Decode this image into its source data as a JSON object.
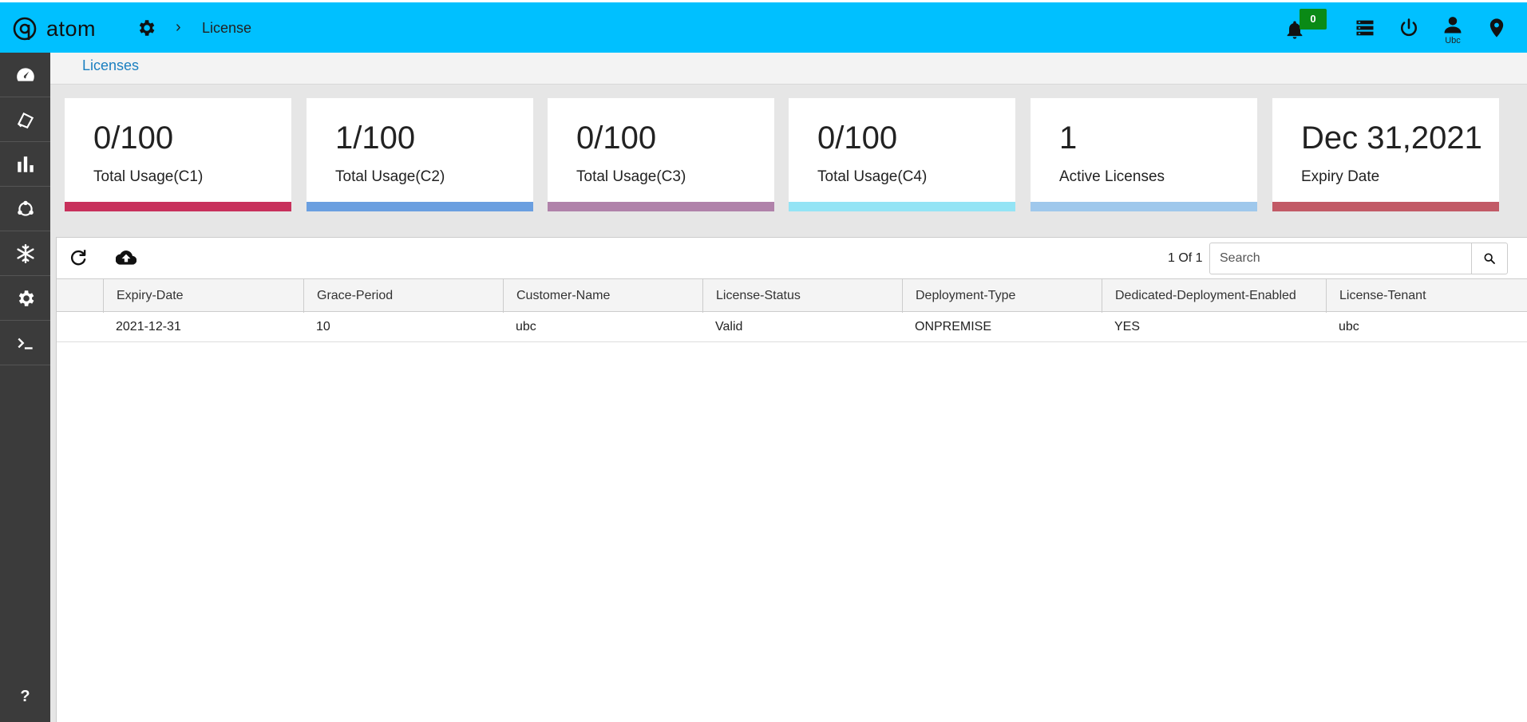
{
  "header": {
    "logo_text": "atom",
    "breadcrumb": "License",
    "notification_count": "0",
    "user_label": "Ubc"
  },
  "subheader": {
    "tab": "Licenses"
  },
  "cards": [
    {
      "value": "0/100",
      "label": "Total Usage(C1)",
      "color": "#c8315c"
    },
    {
      "value": "1/100",
      "label": "Total Usage(C2)",
      "color": "#6a9fe0"
    },
    {
      "value": "0/100",
      "label": "Total Usage(C3)",
      "color": "#b082aa"
    },
    {
      "value": "0/100",
      "label": "Total Usage(C4)",
      "color": "#94e4f5"
    },
    {
      "value": "1",
      "label": "Active Licenses",
      "color": "#9fc8ec"
    },
    {
      "value": "Dec 31,2021",
      "label": "Expiry Date",
      "color": "#c25a66"
    }
  ],
  "table": {
    "page_info": "1 Of 1",
    "search_placeholder": "Search",
    "columns": [
      "Expiry-Date",
      "Grace-Period",
      "Customer-Name",
      "License-Status",
      "Deployment-Type",
      "Dedicated-Deployment-Enabled",
      "License-Tenant"
    ],
    "rows": [
      [
        "2021-12-31",
        "10",
        "ubc",
        "Valid",
        "ONPREMISE",
        "YES",
        "ubc"
      ]
    ]
  },
  "sidebar": {
    "icons": [
      "dashboard-icon",
      "devices-icon",
      "bar-chart-icon",
      "topology-icon",
      "snowflake-icon",
      "settings-icon",
      "terminal-icon"
    ],
    "help_label": "?"
  },
  "colors": {
    "topbar": "#00c0ff",
    "sidebar": "#3b3b3b",
    "accent_link": "#1a7fc0",
    "badge": "#0a8a16"
  }
}
